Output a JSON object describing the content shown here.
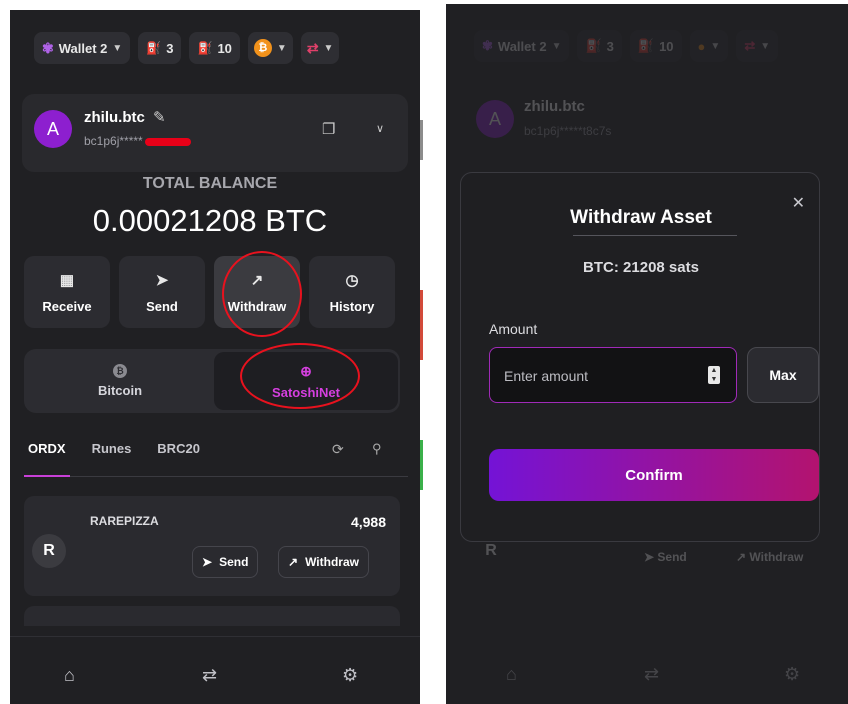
{
  "colors": {
    "accent": "#8d1fcf",
    "highlight": "#e8121e",
    "confirm_start": "#7413d6",
    "confirm_end": "#b3136f"
  },
  "topbar": {
    "wallet_label": "Wallet 2",
    "utxo_a": "3",
    "utxo_b": "10",
    "wallet_icon": "butterfly-icon",
    "chain_icon": "bitcoin-icon",
    "swap_icon": "swap-icon"
  },
  "account": {
    "name": "zhilu.btc",
    "address_left": "bc1p6j*****",
    "address_right": "bc1p6j*****t8c7s",
    "avatar_letter": "А"
  },
  "balance": {
    "label": "TOTAL BALANCE",
    "value": "0.00021208 BTC"
  },
  "actions": [
    {
      "label": "Receive",
      "icon": "qr-icon"
    },
    {
      "label": "Send",
      "icon": "send-icon"
    },
    {
      "label": "Withdraw",
      "icon": "arrow-up-right-icon"
    },
    {
      "label": "History",
      "icon": "clock-icon"
    }
  ],
  "networks": [
    {
      "label": "Bitcoin",
      "icon": "bitcoin-icon"
    },
    {
      "label": "SatoshiNet",
      "icon": "globe-icon"
    }
  ],
  "tabs": [
    "ORDX",
    "Runes",
    "BRC20"
  ],
  "tokens": [
    {
      "letter": "R",
      "name": "RAREPIZZA",
      "amount": "4,988",
      "send_label": "Send",
      "withdraw_label": "Withdraw"
    }
  ],
  "bottom_nav": [
    "home-icon",
    "swap-icon",
    "settings-icon"
  ],
  "modal": {
    "title": "Withdraw Asset",
    "subtitle": "BTC: 21208 sats",
    "amount_label": "Amount",
    "placeholder": "Enter amount",
    "max_label": "Max",
    "confirm_label": "Confirm",
    "close_icon": "close-icon"
  }
}
